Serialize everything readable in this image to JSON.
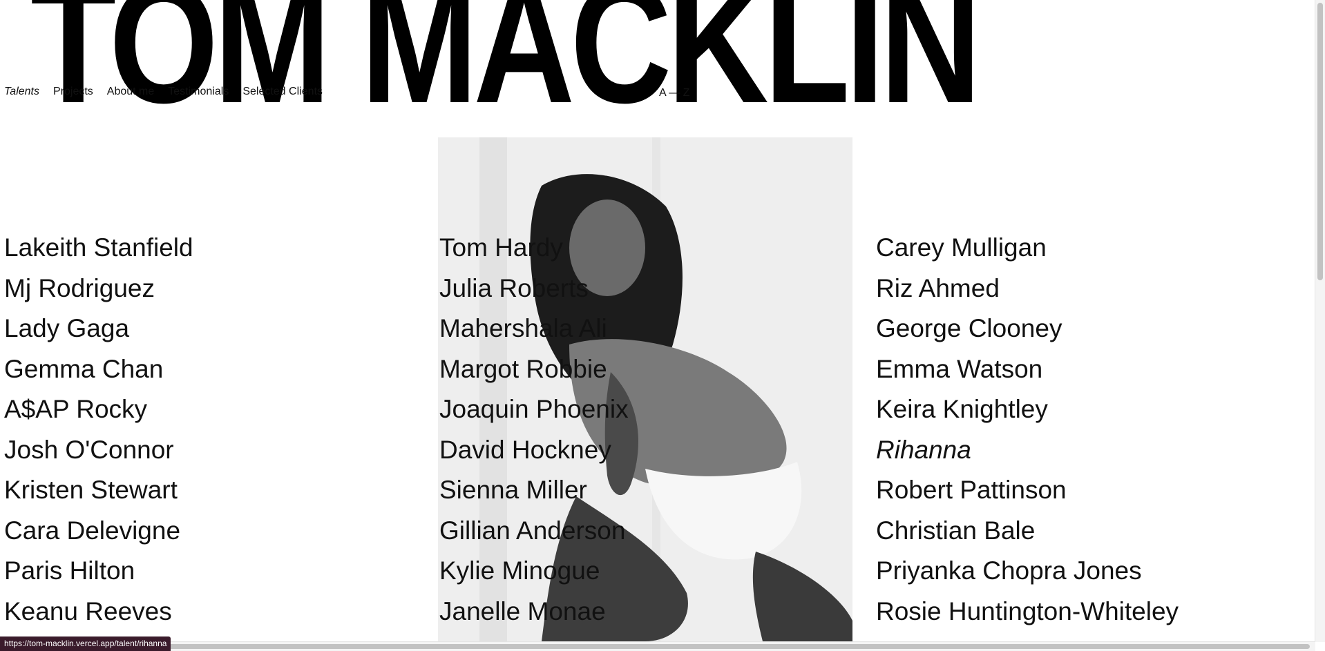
{
  "site": {
    "logo_text": "TOM MACKLIN"
  },
  "nav": {
    "items": [
      {
        "label": "Talents",
        "active": true
      },
      {
        "label": "Projects",
        "active": false
      },
      {
        "label": "About me",
        "active": false
      },
      {
        "label": "Testimonials",
        "active": false
      },
      {
        "label": "Selected Clients",
        "active": false
      }
    ]
  },
  "sort": {
    "label": "A — Z"
  },
  "talents": {
    "column_1": [
      "Lakeith Stanfield",
      "Mj Rodriguez",
      "Lady Gaga",
      "Gemma Chan",
      "A$AP Rocky",
      "Josh O'Connor",
      "Kristen Stewart",
      "Cara Delevigne",
      "Paris Hilton",
      "Keanu Reeves"
    ],
    "column_2": [
      "Tom Hardy",
      "Julia Roberts",
      "Mahershala Ali",
      "Margot Robbie",
      "Joaquin Phoenix",
      "David Hockney",
      "Sienna Miller",
      "Gillian Anderson",
      "Kylie Minogue",
      "Janelle Monae"
    ],
    "column_3": [
      "Carey Mulligan",
      "Riz Ahmed",
      "George Clooney",
      "Emma Watson",
      "Keira Knightley",
      "Rihanna",
      "Robert Pattinson",
      "Christian Bale",
      "Priyanka Chopra Jones",
      "Rosie Huntington-Whiteley"
    ],
    "hovered": "Rihanna"
  },
  "status_bar": {
    "url": "https://tom-macklin.vercel.app/talent/rihanna"
  }
}
